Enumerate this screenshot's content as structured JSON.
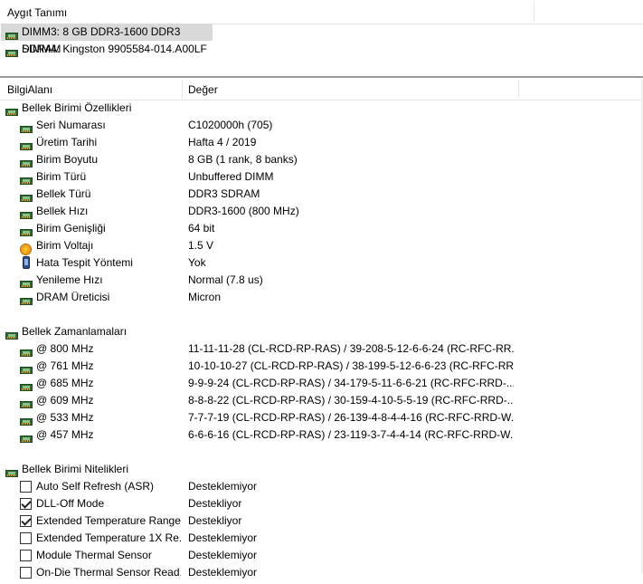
{
  "device_pane": {
    "header": "Aygıt Tanımı",
    "devices": [
      {
        "label": "DIMM3: 8 GB DDR3-1600 DDR3 SDRAM",
        "selected": true,
        "icon": "memory-module-icon"
      },
      {
        "label": "DIMM4: Kingston 9905584-014.A00LF",
        "selected": false,
        "icon": "memory-module-icon"
      }
    ]
  },
  "list": {
    "col_field": "BilgiAlanı",
    "col_value": "Değer",
    "sections": [
      {
        "title": "Bellek Birimi Özellikleri",
        "icon": "memory-module-icon",
        "rows": [
          {
            "field": "Seri Numarası",
            "value": "C1020000h (705)",
            "icon": "memory-module-icon"
          },
          {
            "field": "Üretim Tarihi",
            "value": "Hafta 4 / 2019",
            "icon": "memory-module-icon"
          },
          {
            "field": "Birim Boyutu",
            "value": "8 GB (1 rank, 8 banks)",
            "icon": "memory-module-icon"
          },
          {
            "field": "Birim Türü",
            "value": "Unbuffered DIMM",
            "icon": "memory-module-icon"
          },
          {
            "field": "Bellek Türü",
            "value": "DDR3 SDRAM",
            "icon": "memory-module-icon"
          },
          {
            "field": "Bellek Hızı",
            "value": "DDR3-1600 (800 MHz)",
            "icon": "memory-module-icon"
          },
          {
            "field": "Birim Genişliği",
            "value": "64 bit",
            "icon": "memory-module-icon"
          },
          {
            "field": "Birim Voltajı",
            "value": "1.5 V",
            "icon": "voltage-icon"
          },
          {
            "field": "Hata Tespit Yöntemi",
            "value": "Yok",
            "icon": "device-icon"
          },
          {
            "field": "Yenileme Hızı",
            "value": "Normal (7.8 us)",
            "icon": "memory-module-icon"
          },
          {
            "field": "DRAM Üreticisi",
            "value": "Micron",
            "icon": "memory-module-icon"
          }
        ]
      },
      {
        "title": "Bellek Zamanlamaları",
        "icon": "memory-module-icon",
        "rows": [
          {
            "field": "@ 800 MHz",
            "value": "11-11-11-28  (CL-RCD-RP-RAS) / 39-208-5-12-6-6-24  (RC-RFC-RR...",
            "icon": "memory-module-icon"
          },
          {
            "field": "@ 761 MHz",
            "value": "10-10-10-27  (CL-RCD-RP-RAS) / 38-199-5-12-6-6-23  (RC-RFC-RR...",
            "icon": "memory-module-icon"
          },
          {
            "field": "@ 685 MHz",
            "value": "9-9-9-24  (CL-RCD-RP-RAS) / 34-179-5-11-6-6-21  (RC-RFC-RRD-...",
            "icon": "memory-module-icon"
          },
          {
            "field": "@ 609 MHz",
            "value": "8-8-8-22  (CL-RCD-RP-RAS) / 30-159-4-10-5-5-19  (RC-RFC-RRD-...",
            "icon": "memory-module-icon"
          },
          {
            "field": "@ 533 MHz",
            "value": "7-7-7-19  (CL-RCD-RP-RAS) / 26-139-4-8-4-4-16  (RC-RFC-RRD-W...",
            "icon": "memory-module-icon"
          },
          {
            "field": "@ 457 MHz",
            "value": "6-6-6-16  (CL-RCD-RP-RAS) / 23-119-3-7-4-4-14  (RC-RFC-RRD-W...",
            "icon": "memory-module-icon"
          }
        ]
      },
      {
        "title": "Bellek Birimi Nitelikleri",
        "icon": "memory-module-icon",
        "rows": [
          {
            "field": "Auto Self Refresh (ASR)",
            "value": "Desteklemiyor",
            "checked": false
          },
          {
            "field": "DLL-Off Mode",
            "value": "Destekliyor",
            "checked": true
          },
          {
            "field": "Extended Temperature Range",
            "value": "Destekliyor",
            "checked": true
          },
          {
            "field": "Extended Temperature 1X Re...",
            "value": "Desteklemiyor",
            "checked": false
          },
          {
            "field": "Module Thermal Sensor",
            "value": "Desteklemiyor",
            "checked": false
          },
          {
            "field": "On-Die Thermal Sensor Read...",
            "value": "Desteklemiyor",
            "checked": false
          }
        ]
      }
    ]
  }
}
